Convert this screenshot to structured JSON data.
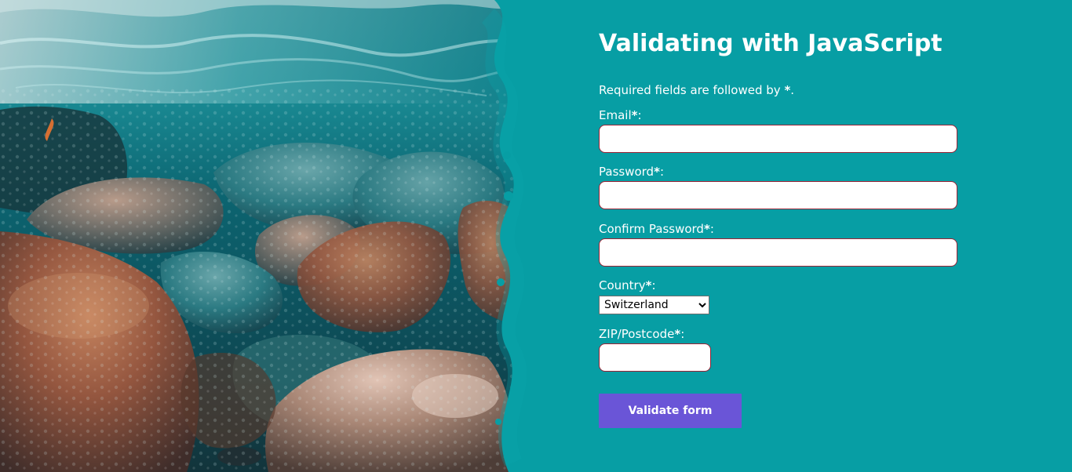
{
  "title": "Validating with JavaScript",
  "note": {
    "text": "Required fields are followed by ",
    "marker": "*",
    "suffix": "."
  },
  "fields": {
    "email": {
      "label": "Email",
      "required_marker": "*",
      "colon": ":",
      "value": ""
    },
    "password": {
      "label": "Password",
      "required_marker": "*",
      "colon": ":",
      "value": ""
    },
    "confirm_password": {
      "label": "Confirm Password",
      "required_marker": "*",
      "colon": ":",
      "value": ""
    },
    "country": {
      "label": "Country",
      "required_marker": "*",
      "colon": ":",
      "selected": "Switzerland"
    },
    "zip": {
      "label": "ZIP/Postcode",
      "required_marker": "*",
      "colon": ":",
      "value": ""
    }
  },
  "button": {
    "label": "Validate form"
  },
  "colors": {
    "background": "#079ea4",
    "button": "#6a55d7",
    "input_border": "#9b2335",
    "text": "#ffffff"
  }
}
